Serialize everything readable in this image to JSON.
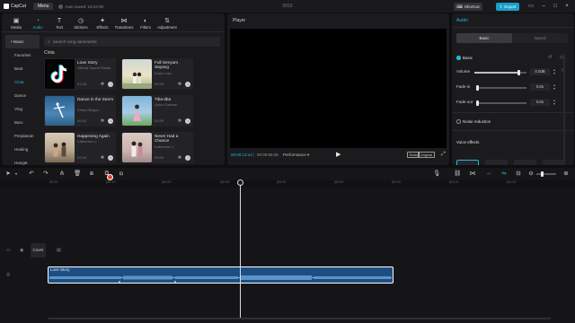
{
  "app": {
    "name": "CapCut",
    "menu_label": "Menu",
    "autosave_text": "Auto saved: 15:24:38",
    "project_title": "0910",
    "shortcut_label": "Shortcut",
    "export_label": "Export",
    "accent_color": "#22b8d8"
  },
  "tool_tabs": [
    {
      "label": "Media",
      "icon": "media-icon"
    },
    {
      "label": "Audio",
      "icon": "audio-icon"
    },
    {
      "label": "Text",
      "icon": "text-icon"
    },
    {
      "label": "Stickers",
      "icon": "stickers-icon"
    },
    {
      "label": "Effects",
      "icon": "effects-icon"
    },
    {
      "label": "Transitions",
      "icon": "transitions-icon"
    },
    {
      "label": "Filters",
      "icon": "filters-icon"
    },
    {
      "label": "Adjustment",
      "icon": "adjustment-icon"
    }
  ],
  "active_tool_tab": "Audio",
  "categories": [
    "• Music",
    "Favorites",
    "Beat",
    "Cinta",
    "Dance",
    "Vlog",
    "Baru",
    "Perjalanan",
    "Healing",
    "Hangat"
  ],
  "active_category": "Cinta",
  "search": {
    "placeholder": "Search song name/artist"
  },
  "section_title": "Cinta",
  "songs": [
    {
      "title": "Love Story",
      "artist": "Official Sound Studio",
      "duration": "01:05"
    },
    {
      "title": "Full Senyum Sayang",
      "artist": "Evan Loss",
      "duration": "00:18"
    },
    {
      "title": "Dance in the Storm",
      "artist": "Chika Mingoo",
      "duration": "00:54"
    },
    {
      "title": "Tiba-tiba",
      "artist": "Quinn Salman",
      "duration": "00:59"
    },
    {
      "title": "Happening Again",
      "artist": "Katherine Li",
      "duration": "02:49"
    },
    {
      "title": "Never Had a Chance",
      "artist": "Katherine Li",
      "duration": "00:54"
    }
  ],
  "player": {
    "heading": "Player",
    "current_time": "00:00:13:14",
    "total_time": "00:00:59:26",
    "performance_label": "Performance",
    "ratio_label": "Ratio",
    "original_label": "Original"
  },
  "inspector": {
    "title": "Audio",
    "segments": [
      "Basic",
      "Speed"
    ],
    "active_segment": "Basic",
    "basic_label": "Basic",
    "volume_label": "Volume",
    "volume_value": "0.0dB",
    "volume_level": 0.86,
    "fade_in_label": "Fade-in",
    "fade_in_value": "0.0s",
    "fade_out_label": "Fade-out",
    "fade_out_value": "0.0s",
    "noise_label": "Noise reduction",
    "voice_effects_label": "Voice effects"
  },
  "timeline": {
    "ruler_ticks": [
      "00:00",
      "|00:10",
      "|00:20",
      "|00:30",
      "|00:40",
      "|00:50",
      "|01:00",
      "|01:10",
      "|01:20"
    ],
    "cover_label": "Cover",
    "clip_label": "Love Story"
  }
}
